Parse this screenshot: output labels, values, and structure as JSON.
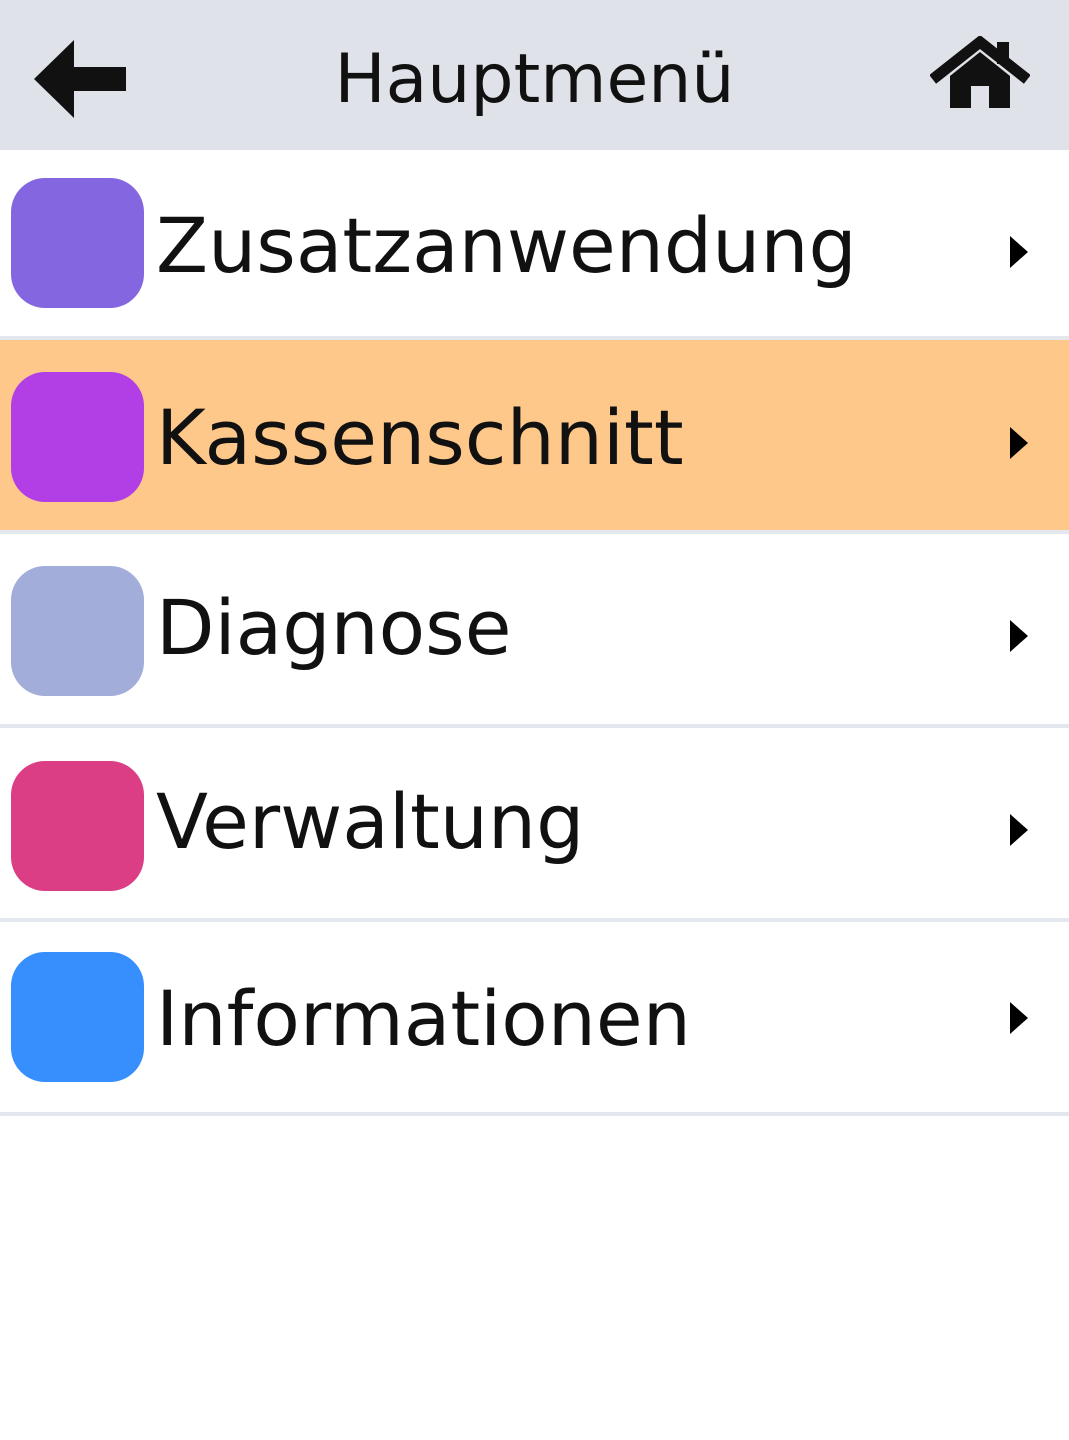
{
  "header": {
    "title": "Hauptmenü",
    "back_icon": "arrow-left-icon",
    "home_icon": "home-icon",
    "background": "#dfe2e8"
  },
  "menu": {
    "items": [
      {
        "label": "Zusatzanwendung",
        "color": "#8467e0",
        "icon": "chevron-right-icon",
        "active": false
      },
      {
        "label": "Kassenschnitt",
        "color": "#b23ee6",
        "icon": "chevron-right-icon",
        "active": true
      },
      {
        "label": "Diagnose",
        "color": "#a2aed9",
        "icon": "chevron-right-icon",
        "active": false
      },
      {
        "label": "Verwaltung",
        "color": "#dc3e85",
        "icon": "chevron-right-icon",
        "active": false
      },
      {
        "label": "Informationen",
        "color": "#378ffe",
        "icon": "chevron-right-icon",
        "active": false
      }
    ],
    "active_background": "#ffc88b"
  }
}
